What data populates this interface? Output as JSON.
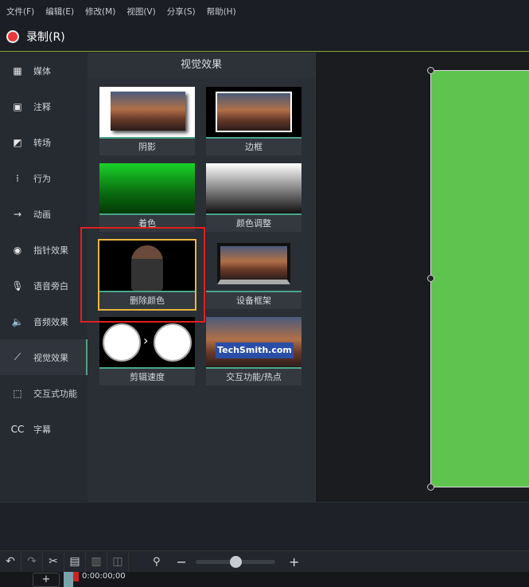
{
  "menu": [
    "文件(F)",
    "编辑(E)",
    "修改(M)",
    "视图(V)",
    "分享(S)",
    "帮助(H)"
  ],
  "record": "录制(R)",
  "sidebar": [
    {
      "label": "媒体",
      "icon": "film-icon"
    },
    {
      "label": "注释",
      "icon": "annotation-icon"
    },
    {
      "label": "转场",
      "icon": "transition-icon"
    },
    {
      "label": "行为",
      "icon": "behavior-icon"
    },
    {
      "label": "动画",
      "icon": "animation-icon"
    },
    {
      "label": "指针效果",
      "icon": "cursor-icon"
    },
    {
      "label": "语音旁白",
      "icon": "microphone-icon"
    },
    {
      "label": "音频效果",
      "icon": "speaker-icon"
    },
    {
      "label": "视觉效果",
      "icon": "magic-wand-icon",
      "active": true
    },
    {
      "label": "交互式功能",
      "icon": "interactive-icon"
    },
    {
      "label": "字幕",
      "icon": "cc-icon"
    }
  ],
  "panel": {
    "title": "视觉效果",
    "effects": [
      "阴影",
      "边框",
      "着色",
      "颜色调整",
      "删除颜色",
      "设备框架",
      "剪辑速度",
      "交互功能/热点"
    ],
    "selected": "删除颜色",
    "hotspot_text": "TechSmith.com"
  },
  "toolbar": {
    "zoom_level": 0.5
  },
  "timeline": {
    "timecode": "0:00:00;00",
    "add": "+"
  },
  "colors": {
    "canvas": "#5ec34f",
    "record": "#e8383b",
    "highlight": "#e02020"
  }
}
